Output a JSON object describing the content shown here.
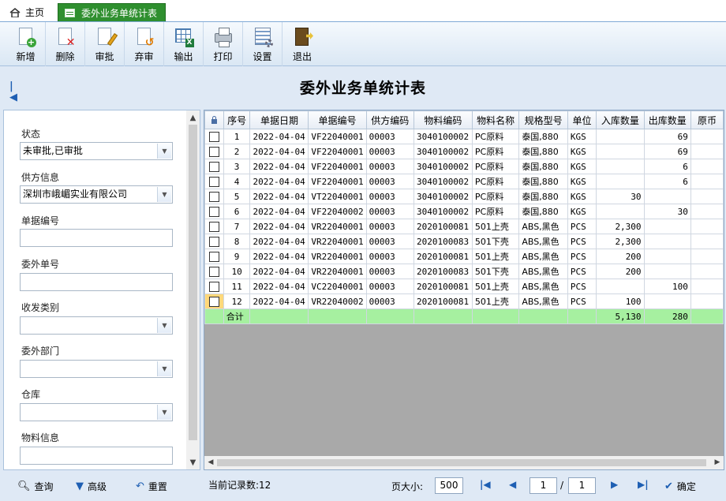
{
  "tabs": [
    {
      "label": "主页",
      "icon": "home-icon"
    },
    {
      "label": "委外业务单统计表",
      "icon": "sheet-icon"
    }
  ],
  "toolbar": {
    "add": "新增",
    "delete": "删除",
    "approve": "审批",
    "abandon": "弃审",
    "export": "输出",
    "print": "打印",
    "settings": "设置",
    "exit": "退出"
  },
  "title": "委外业务单统计表",
  "filter": {
    "status_label": "状态",
    "status_value": "未审批,已审批",
    "supplier_label": "供方信息",
    "supplier_value": "深圳市峨嵋实业有限公司",
    "doc_no_label": "单据编号",
    "outsource_no_label": "委外单号",
    "io_type_label": "收发类别",
    "dept_label": "委外部门",
    "warehouse_label": "仓库",
    "material_label": "物料信息"
  },
  "table": {
    "columns": [
      "序号",
      "单据日期",
      "单据编号",
      "供方编码",
      "物料编码",
      "物料名称",
      "规格型号",
      "单位",
      "入库数量",
      "出库数量",
      "原币"
    ],
    "rows": [
      [
        "1",
        "2022-04-04",
        "VF22040001",
        "00003",
        "3040100002",
        "PC原料",
        "泰国,880",
        "KGS",
        "",
        "69"
      ],
      [
        "2",
        "2022-04-04",
        "VF22040001",
        "00003",
        "3040100002",
        "PC原料",
        "泰国,880",
        "KGS",
        "",
        "69"
      ],
      [
        "3",
        "2022-04-04",
        "VF22040001",
        "00003",
        "3040100002",
        "PC原料",
        "泰国,880",
        "KGS",
        "",
        "6"
      ],
      [
        "4",
        "2022-04-04",
        "VF22040001",
        "00003",
        "3040100002",
        "PC原料",
        "泰国,880",
        "KGS",
        "",
        "6"
      ],
      [
        "5",
        "2022-04-04",
        "VT22040001",
        "00003",
        "3040100002",
        "PC原料",
        "泰国,880",
        "KGS",
        "30",
        ""
      ],
      [
        "6",
        "2022-04-04",
        "VF22040002",
        "00003",
        "3040100002",
        "PC原料",
        "泰国,880",
        "KGS",
        "",
        "30"
      ],
      [
        "7",
        "2022-04-04",
        "VR22040001",
        "00003",
        "2020100081",
        "501上壳",
        "ABS,黑色",
        "PCS",
        "2,300",
        ""
      ],
      [
        "8",
        "2022-04-04",
        "VR22040001",
        "00003",
        "2020100083",
        "501下壳",
        "ABS,黑色",
        "PCS",
        "2,300",
        ""
      ],
      [
        "9",
        "2022-04-04",
        "VR22040001",
        "00003",
        "2020100081",
        "501上壳",
        "ABS,黑色",
        "PCS",
        "200",
        ""
      ],
      [
        "10",
        "2022-04-04",
        "VR22040001",
        "00003",
        "2020100083",
        "501下壳",
        "ABS,黑色",
        "PCS",
        "200",
        ""
      ],
      [
        "11",
        "2022-04-04",
        "VC22040001",
        "00003",
        "2020100081",
        "501上壳",
        "ABS,黑色",
        "PCS",
        "",
        "100"
      ],
      [
        "12",
        "2022-04-04",
        "VR22040002",
        "00003",
        "2020100081",
        "501上壳",
        "ABS,黑色",
        "PCS",
        "100",
        ""
      ]
    ],
    "total_label": "合计",
    "total_in": "5,130",
    "total_out": "280"
  },
  "bottom": {
    "query": "查询",
    "advanced": "高级",
    "reset": "重置",
    "record_count": "当前记录数:12",
    "page_size_label": "页大小:",
    "page_size": "500",
    "current_page": "1",
    "page_sep": "/",
    "total_pages": "1",
    "confirm": "确定"
  }
}
